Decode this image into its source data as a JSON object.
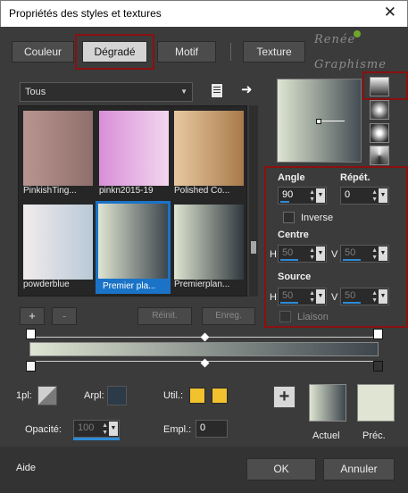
{
  "window": {
    "title": "Propriétés des styles et textures",
    "close_glyph": "✕"
  },
  "tabs": [
    {
      "label": "Couleur"
    },
    {
      "label": "Dégradé"
    },
    {
      "label": "Motif"
    },
    {
      "label": "Texture"
    }
  ],
  "watermark": {
    "line1": "Renée",
    "line2": "Graphisme"
  },
  "library": {
    "category": "Tous",
    "items": [
      {
        "label": "PinkishTing...",
        "colors": [
          "#b99590",
          "#8f6f6c"
        ]
      },
      {
        "label": "pinkn2015-19",
        "colors": [
          "#d88fd8",
          "#f2d6ef"
        ]
      },
      {
        "label": "Polished Co...",
        "colors": [
          "#e8c9a0",
          "#a77a4b"
        ]
      },
      {
        "label": "powderblue",
        "colors": [
          "#f1ecec",
          "#b9c9d7"
        ]
      },
      {
        "label": "Premier pla...",
        "colors": [
          "#dfe5d2",
          "#3d464d"
        ]
      },
      {
        "label": "Premierplan...",
        "colors": [
          "#dfe5d2",
          "#2f383e"
        ]
      }
    ],
    "selected_index": 4
  },
  "buttons": {
    "add": "+",
    "remove": "-",
    "reset": "Réinit.",
    "save": "Enreg."
  },
  "gradient_settings": {
    "angle_label": "Angle",
    "angle_value": "90",
    "repeat_label": "Répét.",
    "repeat_value": "0",
    "invert_label": "Inverse",
    "centre_label": "Centre",
    "centre_h": "50",
    "centre_v": "50",
    "source_label": "Source",
    "source_h": "50",
    "source_v": "50",
    "link_label": "Liaison",
    "h_label": "H",
    "v_label": "V"
  },
  "stops": {
    "pl_label": "1pl:",
    "arpl_label": "Arpl:",
    "util_label": "Util.:",
    "opacity_label": "Opacité:",
    "opacity_value": "100",
    "empl_label": "Empl.:",
    "empl_value": "0",
    "util_colors": [
      "#f2c12e",
      "#f2c12e"
    ]
  },
  "swatches": {
    "add": "+",
    "current_label": "Actuel",
    "previous_label": "Préc.",
    "current_colors": [
      "#dfe5d2",
      "#3d464d"
    ],
    "previous_color": "#dfe5d2"
  },
  "footer": {
    "help": "Aide",
    "ok": "OK",
    "cancel": "Annuler"
  },
  "colors": {
    "accent": "#1a73c7",
    "highlight_box": "#8b1010",
    "background": "#3b3b3b"
  }
}
